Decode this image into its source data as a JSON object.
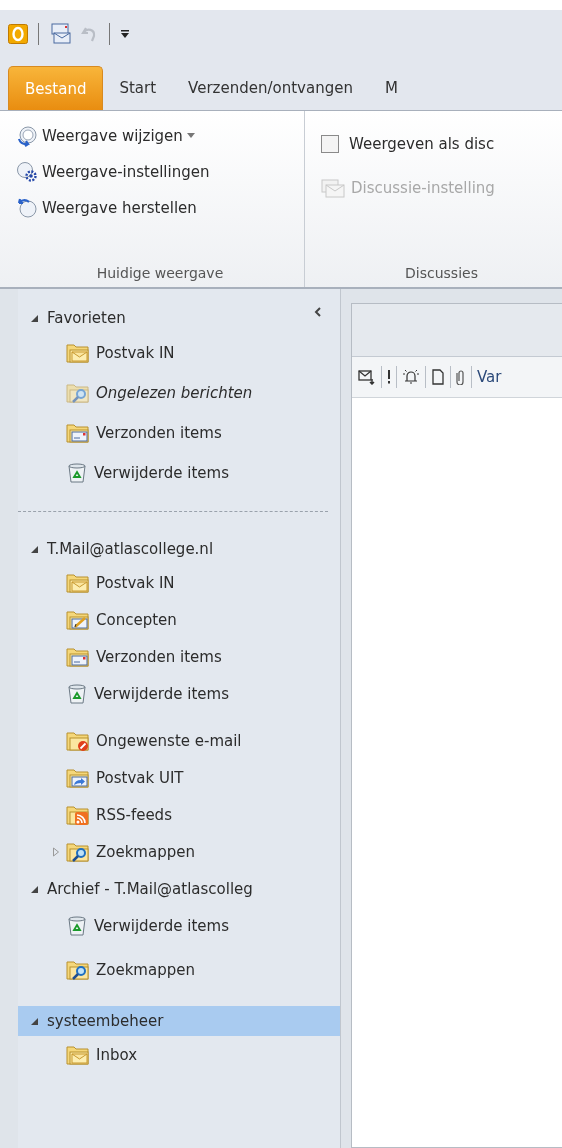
{
  "tabs": [
    {
      "label": "Bestand",
      "selected": true
    },
    {
      "label": "Start",
      "selected": false
    },
    {
      "label": "Verzenden/ontvangen",
      "selected": false
    },
    {
      "label": "M",
      "selected": false
    }
  ],
  "ribbon": {
    "groups": [
      {
        "label": "Huidige weergave",
        "controls": [
          {
            "kind": "change-view",
            "label": "Weergave wijzigen",
            "dropdown": true
          },
          {
            "kind": "view-settings",
            "label": "Weergave-instellingen",
            "dropdown": false
          },
          {
            "kind": "reset-view",
            "label": "Weergave herstellen",
            "dropdown": false
          }
        ]
      },
      {
        "label": "Discussies",
        "controls": [
          {
            "kind": "checkbox",
            "label": "Weergeven als disc",
            "checked": false
          },
          {
            "kind": "conversation-settings",
            "label": "Discussie-instelling",
            "disabled": true
          }
        ]
      }
    ]
  },
  "navigation": {
    "sections": [
      {
        "label": "Favorieten",
        "expanded": true,
        "selected": false,
        "items": [
          {
            "kind": "inbox",
            "label": "Postvak IN",
            "selected": false
          },
          {
            "kind": "unread-search",
            "label": "Ongelezen berichten",
            "selected": false
          },
          {
            "kind": "sent",
            "label": "Verzonden items",
            "selected": false
          },
          {
            "kind": "trash",
            "label": "Verwijderde items",
            "selected": false
          }
        ]
      },
      {
        "label": "T.Mail@atlascollege.nl",
        "expanded": true,
        "selected": false,
        "items": [
          {
            "kind": "inbox",
            "label": "Postvak IN",
            "selected": false
          },
          {
            "kind": "drafts",
            "label": "Concepten",
            "selected": false
          },
          {
            "kind": "sent",
            "label": "Verzonden items",
            "selected": false
          },
          {
            "kind": "trash",
            "label": "Verwijderde items",
            "selected": false
          },
          {
            "kind": "junk",
            "label": "Ongewenste e-mail",
            "selected": false
          },
          {
            "kind": "outbox",
            "label": "Postvak UIT",
            "selected": false
          },
          {
            "kind": "rss",
            "label": "RSS-feeds",
            "selected": false
          },
          {
            "kind": "search",
            "label": "Zoekmappen",
            "selected": false,
            "expanded": false
          }
        ]
      },
      {
        "label": "Archief - T.Mail@atlascolleg",
        "expanded": true,
        "selected": false,
        "items": [
          {
            "kind": "trash",
            "label": "Verwijderde items",
            "selected": false
          },
          {
            "kind": "search",
            "label": "Zoekmappen",
            "selected": false
          }
        ]
      },
      {
        "label": "systeembeheer",
        "expanded": true,
        "selected": true,
        "items": [
          {
            "kind": "inbox",
            "label": "Inbox",
            "selected": false
          }
        ]
      }
    ]
  },
  "message_list": {
    "column_header": "Var"
  }
}
